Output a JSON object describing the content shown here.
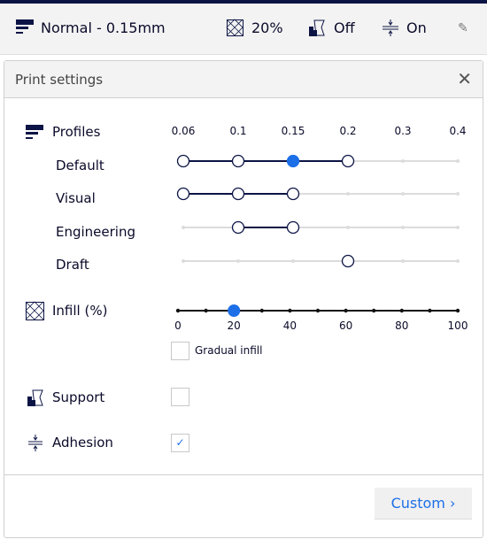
{
  "topbar": {
    "profile": "Normal - 0.15mm",
    "infill": "20%",
    "support": "Off",
    "adhesion": "On",
    "icons": [
      "profile-icon",
      "infill-icon",
      "support-icon",
      "adhesion-icon",
      "pencil-icon"
    ]
  },
  "panel": {
    "title": "Print settings",
    "close_icon": "close-icon"
  },
  "profiles": {
    "label": "Profiles",
    "columns": [
      "0.06",
      "0.1",
      "0.15",
      "0.2",
      "0.3",
      "0.4"
    ],
    "rows": [
      {
        "label": "Default",
        "available": [
          0,
          1,
          2,
          3
        ],
        "selected": 2
      },
      {
        "label": "Visual",
        "available": [
          0,
          1,
          2
        ],
        "selected": null
      },
      {
        "label": "Engineering",
        "available": [
          1,
          2
        ],
        "selected": null
      },
      {
        "label": "Draft",
        "available": [
          3
        ],
        "selected": null
      }
    ]
  },
  "infill": {
    "label": "Infill (%)",
    "value": 20,
    "min": 0,
    "max": 100,
    "step": 10,
    "tick_labels": [
      "0",
      "20",
      "40",
      "60",
      "80",
      "100"
    ],
    "gradual_label": "Gradual infill",
    "gradual_checked": false
  },
  "support": {
    "label": "Support",
    "checked": false
  },
  "adhesion": {
    "label": "Adhesion",
    "checked": true
  },
  "footer": {
    "custom_label": "Custom"
  },
  "colors": {
    "accent": "#1d6fe8",
    "navy": "#0c1445",
    "track": "#dcdcdc"
  }
}
